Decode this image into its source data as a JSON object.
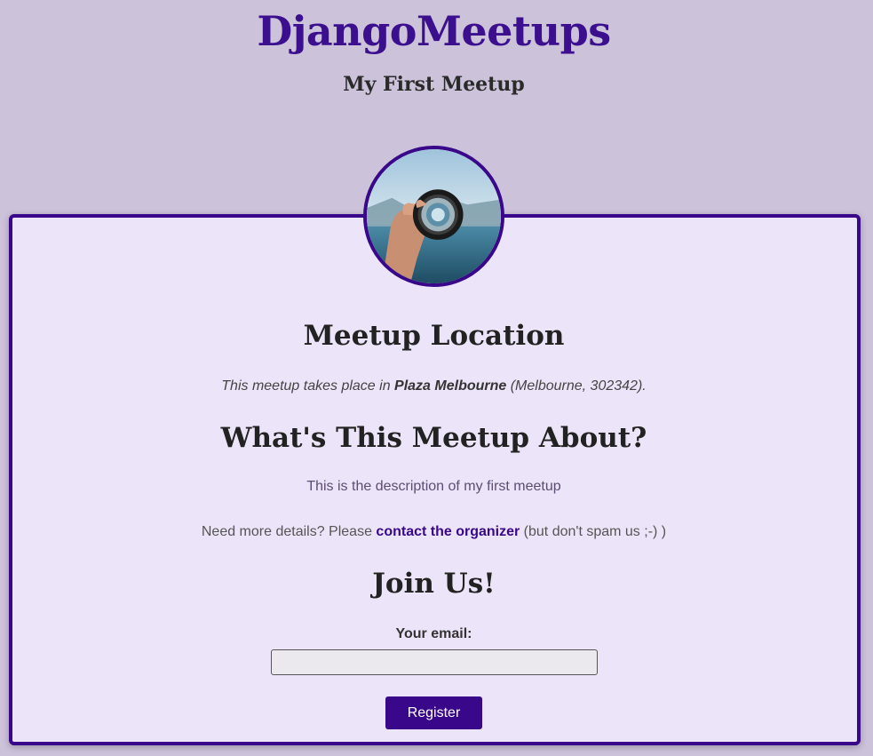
{
  "header": {
    "site_title": "DjangoMeetups",
    "meetup_title": "My First Meetup"
  },
  "avatar": {
    "icon": "lens-photo",
    "alt": "camera lens held in hand"
  },
  "location": {
    "heading": "Meetup Location",
    "prefix": "This meetup takes place in ",
    "venue": "Plaza Melbourne",
    "suffix": " (Melbourne, 302342)."
  },
  "about": {
    "heading": "What's This Meetup About?",
    "description": "This is the description of my first meetup",
    "contact_prefix": "Need more details? Please ",
    "contact_link": "contact the organizer",
    "contact_suffix": " (but don't spam us ;-) )"
  },
  "join": {
    "heading": "Join Us!",
    "email_label": "Your email:",
    "email_value": "",
    "email_placeholder": "",
    "register_label": "Register"
  },
  "colors": {
    "background": "#ccc2da",
    "accent": "#38078a",
    "card": "#ece4f8"
  }
}
